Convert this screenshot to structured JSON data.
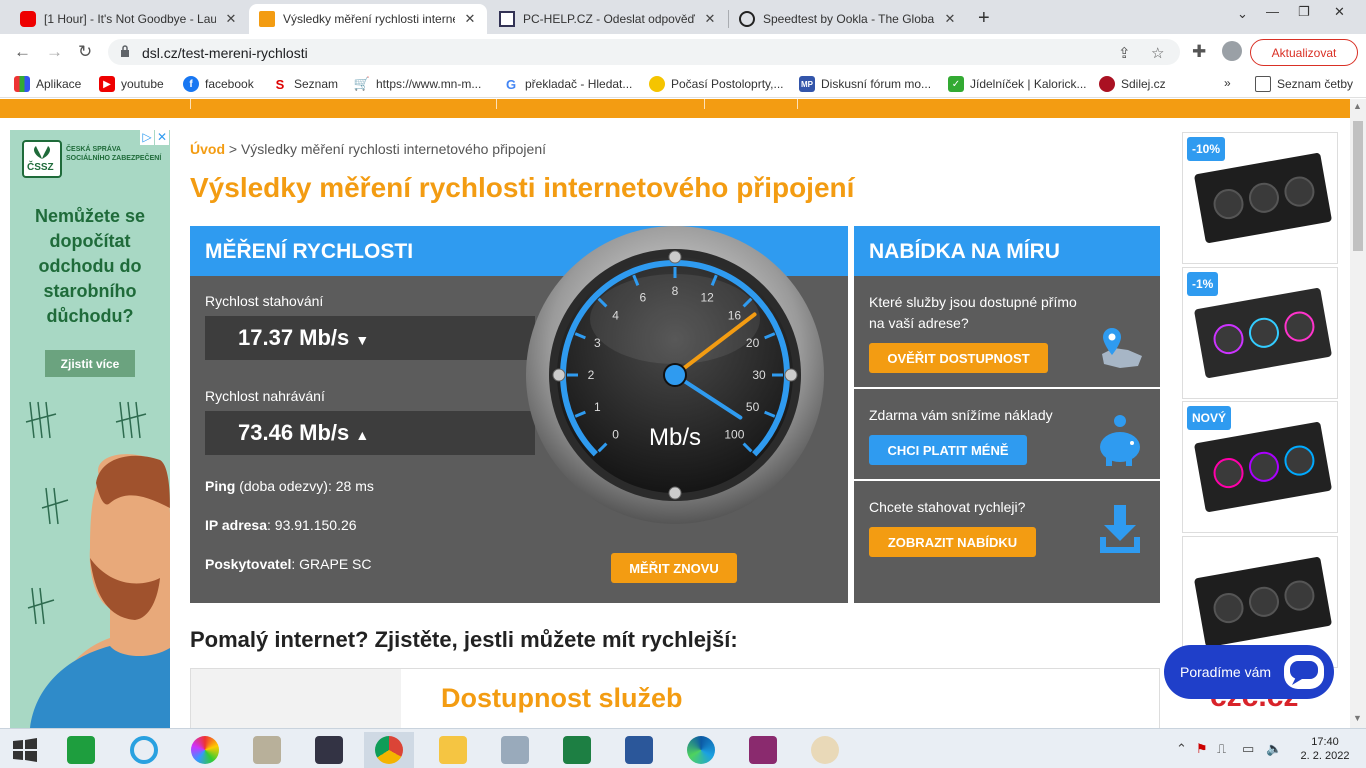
{
  "browser": {
    "tabs": [
      {
        "title": "[1 Hour] - It's Not Goodbye - Lau",
        "icon": "youtube-icon",
        "active": false
      },
      {
        "title": "Výsledky měření rychlosti interne",
        "icon": "dsl-icon",
        "active": true
      },
      {
        "title": "PC-HELP.CZ - Odeslat odpověď",
        "icon": "pchelp-icon",
        "active": false
      },
      {
        "title": "Speedtest by Ookla - The Global",
        "icon": "speedtest-icon",
        "active": false
      }
    ],
    "url": "dsl.cz/test-mereni-rychlosti",
    "update_label": "Aktualizovat",
    "bookmarks": [
      {
        "label": "Aplikace"
      },
      {
        "label": "youtube"
      },
      {
        "label": "facebook"
      },
      {
        "label": "Seznam"
      },
      {
        "label": "https://www.mn-m..."
      },
      {
        "label": "překladač - Hledat..."
      },
      {
        "label": "Počasí Postoloprty,..."
      },
      {
        "label": "Diskusní fórum mo..."
      },
      {
        "label": "Jídelníček | Kalorick..."
      },
      {
        "label": "Sdilej.cz"
      }
    ],
    "bookmarks_more": "»",
    "reading_list": "Seznam četby",
    "colors": {
      "accent": "#f39c12",
      "blue": "#2f9bf0",
      "panel": "#5c5c5c"
    }
  },
  "page": {
    "breadcrumb_home": "Úvod",
    "breadcrumb_sep": ">",
    "breadcrumb_current": "Výsledky měření rychlosti internetového připojení",
    "title": "Výsledky měření rychlosti internetového připojení",
    "speed": {
      "header": "MĚŘENÍ RYCHLOSTI",
      "download_label": "Rychlost stahování",
      "download_value": "17.37 Mb/s",
      "upload_label": "Rychlost nahrávání",
      "upload_value": "73.46 Mb/s",
      "ping_label": "Ping",
      "ping_note": "(doba odezvy):",
      "ping_value": "28 ms",
      "ip_label": "IP adresa",
      "ip_value": "93.91.150.26",
      "provider_label": "Poskytovatel",
      "provider_value": "GRAPE SC",
      "remeasure": "MĚŘIT ZNOVU",
      "gauge_unit": "Mb/s",
      "gauge_ticks": [
        "0",
        "1",
        "2",
        "3",
        "4",
        "6",
        "8",
        "12",
        "16",
        "20",
        "30",
        "50",
        "100"
      ],
      "download_mbps": 17.37,
      "upload_mbps": 73.46
    },
    "offer": {
      "header": "NABÍDKA NA MÍRU",
      "rows": [
        {
          "text": "Které služby jsou dostupné přímo na vaší adrese?",
          "button": "OVĚŘIT DOSTUPNOST"
        },
        {
          "text": "Zdarma vám snížíme náklady",
          "button": "CHCI PLATIT MÉNĚ"
        },
        {
          "text": "Chcete stahovat rychleji?",
          "button": "ZOBRAZIT NABÍDKU"
        }
      ]
    },
    "subtitle": "Pomalý internet? Zjistěte, jestli můžete mít rychlejší:",
    "availability": "Dostupnost služeb"
  },
  "ad_left": {
    "org": "ČESKÁ SPRÁVA SOCIÁLNÍHO ZABEZPEČENÍ",
    "logo": "ČSSZ",
    "headline": "Nemůžete se dopočítat odchodu do starobního důchodu?",
    "button": "Zjistit více"
  },
  "ad_right": {
    "badges": [
      "-10%",
      "-1%",
      "NOVÝ"
    ],
    "brand": "czc.cz"
  },
  "chat": {
    "label": "Poradíme vám"
  },
  "taskbar": {
    "time": "17:40",
    "date": "2. 2. 2022"
  }
}
